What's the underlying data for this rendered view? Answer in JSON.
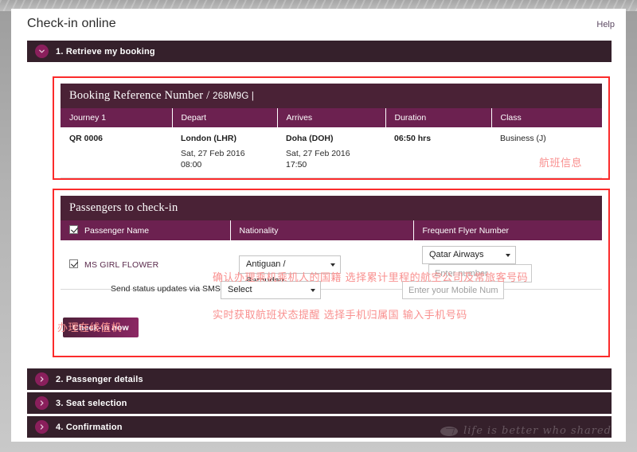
{
  "header": {
    "title": "Check-in online",
    "help_label": "Help"
  },
  "accordions": [
    {
      "label": "1. Retrieve my booking",
      "icon": "chevron-down-icon",
      "expanded": true
    },
    {
      "label": "2. Passenger details",
      "icon": "chevron-right-icon",
      "expanded": false
    },
    {
      "label": "3. Seat selection",
      "icon": "chevron-right-icon",
      "expanded": false
    },
    {
      "label": "4. Confirmation",
      "icon": "chevron-right-icon",
      "expanded": false
    }
  ],
  "booking": {
    "panel_title": "Booking Reference Number /",
    "reference": "268M9G |",
    "columns": [
      "Journey 1",
      "Depart",
      "Arrives",
      "Duration",
      "Class"
    ],
    "row": {
      "flight": "QR 0006",
      "depart_city": "London (LHR)",
      "depart_date": "Sat, 27 Feb 2016",
      "depart_time": "08:00",
      "arrive_city": "Doha (DOH)",
      "arrive_date": "Sat, 27 Feb 2016",
      "arrive_time": "17:50",
      "duration": "06:50 hrs",
      "class": "Business (J)"
    }
  },
  "passengers": {
    "panel_title": "Passengers to check-in",
    "columns": [
      "Passenger Name",
      "Nationality",
      "Frequent Flyer Number"
    ],
    "row": {
      "name": "MS GIRL  FLOWER",
      "nationality_value": "Antiguan / Barbudan",
      "frequent_flyer_value": "Qatar Airways",
      "frequent_flyer_number_placeholder": "Enter number"
    },
    "sms": {
      "label": "Send status updates via SMS",
      "country_value": "Select",
      "number_placeholder": "Enter your Mobile Number"
    },
    "checkin_button": "Check-in now"
  },
  "annotations": {
    "flight_info": "航班信息",
    "nationality": "确认办理乘机乘机人的国籍   选择累计里程的航空公司及常旅客号码",
    "sms": "实时获取航班状态提醒 选择手机归属国 输入手机号码",
    "checkin": "办理在线值机"
  },
  "watermark": {
    "text": "life is better who shared"
  },
  "colors": {
    "accordion_bg": "#35202b",
    "panel_title_bg": "#4a2236",
    "table_header_bg": "#6c2150",
    "chevron_bg": "#8a1f5c",
    "annotation_red": "#f9908f",
    "annotation_box_border": "#fb2b2b",
    "button_gradient_start": "#4e2239",
    "button_gradient_end": "#8d2864"
  }
}
